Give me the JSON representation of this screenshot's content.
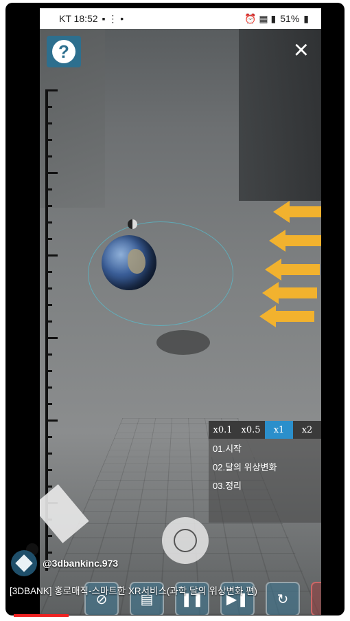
{
  "status_bar": {
    "carrier_time": "KT 18:52",
    "battery": "51%"
  },
  "buttons": {
    "help_symbol": "?",
    "close_symbol": "×"
  },
  "speed_options": [
    {
      "label": "x0.1",
      "active": false
    },
    {
      "label": "x0.5",
      "active": false
    },
    {
      "label": "x1",
      "active": true
    },
    {
      "label": "x2",
      "active": false
    }
  ],
  "menu": [
    {
      "label": "01.시작",
      "active": true
    },
    {
      "label": "02.달의 위상변화",
      "active": false
    },
    {
      "label": "03.정리",
      "active": false
    }
  ],
  "channel": {
    "handle": "@3dbankinc.973"
  },
  "video": {
    "title": "[3DBANK] 홍로매직-스마트한 XR서비스(과학 달의 위상변화 편)"
  },
  "toolbar_icons": [
    "ruler-off-icon",
    "layers-icon",
    "pause-icon",
    "next-icon",
    "rotate-icon",
    "microphone-icon"
  ],
  "colors": {
    "accent_blue": "#2b8fcb",
    "help_blue": "#2d6f8e",
    "arrow_yellow": "#f2b22e"
  }
}
